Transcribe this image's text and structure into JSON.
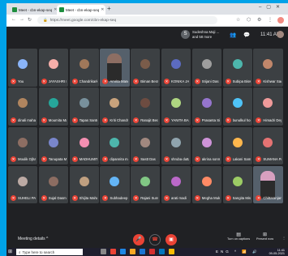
{
  "browser": {
    "tabs": [
      {
        "label": "Meet - cbn-ekap-seq",
        "active": false,
        "favicon": "meet-icon"
      },
      {
        "label": "Meet - cbn-ekap-seq",
        "active": true,
        "favicon": "meet-icon"
      }
    ],
    "new_tab_label": "+",
    "url": "https://meet.google.com/cbn-ekap-seq"
  },
  "meet": {
    "presenter": {
      "initial": "S",
      "name": "Sudeshna Maji ... and 58 more"
    },
    "time": "11:41 AM",
    "participants": [
      {
        "name": "You",
        "color": "#8ab4f8",
        "video": false
      },
      {
        "name": "JAYASHRI ROY",
        "color": "#f6aea9",
        "video": false
      },
      {
        "name": "Chandrikarke...",
        "color": "#a0785a",
        "video": false
      },
      {
        "name": "Amrita Mandal",
        "color": "#8d6e63",
        "video": true
      },
      {
        "name": "Biman Bera",
        "color": "#7a5c4a",
        "video": false
      },
      {
        "name": "KONIKA JANA ...",
        "color": "#5c6bc0",
        "video": false
      },
      {
        "name": "Srijani Das",
        "color": "#9e9e9e",
        "video": false
      },
      {
        "name": "Subipa Biswas",
        "color": "#4db6ac",
        "video": false
      },
      {
        "name": "Kishwar Sadak",
        "color": "#c1876b",
        "video": false
      },
      {
        "name": "dinali mahapat...",
        "color": "#b0855f",
        "video": false
      },
      {
        "name": "Moumita Maji",
        "color": "#26a69a",
        "video": false
      },
      {
        "name": "Tapas Santra",
        "color": "#78909c",
        "video": false
      },
      {
        "name": "Kriti Chandra",
        "color": "#c8a27c",
        "video": false
      },
      {
        "name": "Ranajit Bera",
        "color": "#6d4c41",
        "video": false
      },
      {
        "name": "YANITA BANE...",
        "color": "#aed581",
        "video": false
      },
      {
        "name": "Prasanta Sing",
        "color": "#9575cd",
        "video": false
      },
      {
        "name": "bunulkul hora...",
        "color": "#4fc3f7",
        "video": false
      },
      {
        "name": "Himadri Dey",
        "color": "#ef9a9a",
        "video": false
      },
      {
        "name": "Moulik Ojha",
        "color": "#8d6e63",
        "video": false
      },
      {
        "name": "Tanupata Mai...",
        "color": "#7986cb",
        "video": false
      },
      {
        "name": "MADHUMITA ...",
        "color": "#f48fb1",
        "video": false
      },
      {
        "name": "dipannita ma...",
        "color": "#4db6ac",
        "video": false
      },
      {
        "name": "Sastt Das",
        "color": "#a1887f",
        "video": false
      },
      {
        "name": "shruba dutta",
        "color": "#90a4ae",
        "video": false
      },
      {
        "name": "akrina sonm",
        "color": "#ce93d8",
        "video": false
      },
      {
        "name": "Lakani Samanta",
        "color": "#ffb74d",
        "video": false
      },
      {
        "name": "SUMANA PAL",
        "color": "#e57373",
        "video": false
      },
      {
        "name": "SUHELI PAKE...",
        "color": "#bcaaa4",
        "video": false
      },
      {
        "name": "Sujal Dasmah...",
        "color": "#8c6d62",
        "video": false
      },
      {
        "name": "Shijita Mahata",
        "color": "#c0a080",
        "video": false
      },
      {
        "name": "Subhadeep Pr...",
        "color": "#64b5f6",
        "video": false
      },
      {
        "name": "Rajani Sunwal",
        "color": "#81c784",
        "video": false
      },
      {
        "name": "arati madi",
        "color": "#ba68c8",
        "video": false
      },
      {
        "name": "Megha Mukhe...",
        "color": "#ff8a65",
        "video": false
      },
      {
        "name": "Sangita Mishra",
        "color": "#9ccc65",
        "video": false
      },
      {
        "name": "Chittaranjan...",
        "color": "#d7a0c0",
        "video": true
      }
    ],
    "meeting_details_label": "Meeting details",
    "captions_label": "Turn on captions",
    "present_label": "Present now"
  },
  "taskbar": {
    "search_placeholder": "Type here to search",
    "tray_language": "ENG",
    "tray_time": "11:41",
    "tray_date": "09-05-2021"
  },
  "colors": {
    "meet_bg": "#202124",
    "tile_bg": "#3c4043",
    "mic_off_red": "#ea4335",
    "desktop_blue": "#00a2e8"
  }
}
